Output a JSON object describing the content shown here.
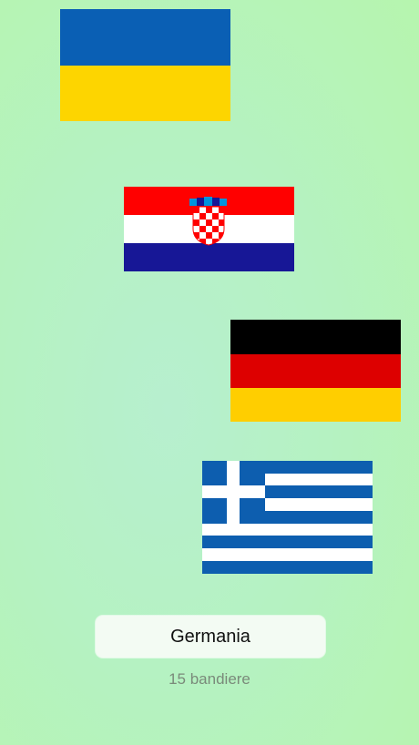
{
  "flags": [
    {
      "country": "Ukraine",
      "colors": [
        "#0057b8",
        "#ffd700"
      ]
    },
    {
      "country": "Croatia",
      "colors": [
        "#ff0000",
        "#ffffff",
        "#171796"
      ]
    },
    {
      "country": "Germany",
      "colors": [
        "#000000",
        "#dd0000",
        "#ffce00"
      ]
    },
    {
      "country": "Greece",
      "colors": [
        "#0d5eaf",
        "#ffffff"
      ]
    }
  ],
  "answer_label": "Germania",
  "counter_text": "15 bandiere"
}
